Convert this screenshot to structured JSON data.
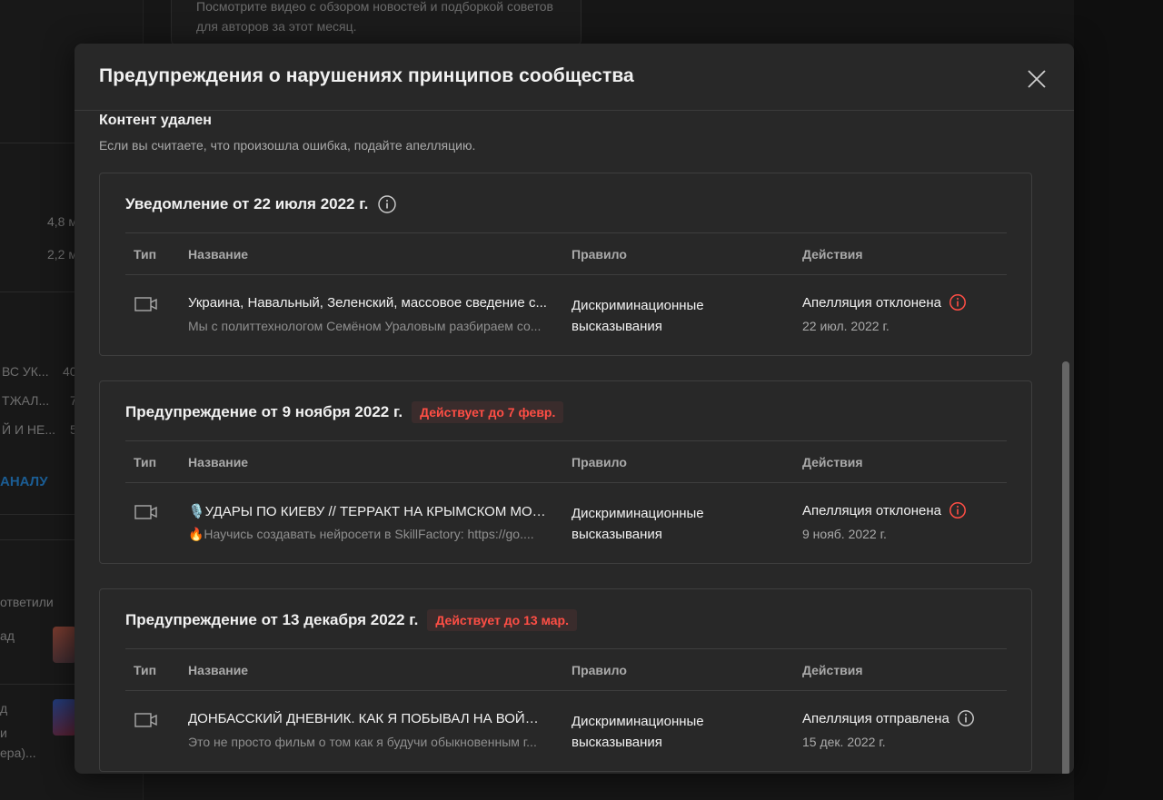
{
  "background": {
    "card_text": "Посмотрите видео с обзором новостей и подборкой советов для авторов за этот месяц.",
    "stats": [
      "4,8 м",
      "2,2 м"
    ],
    "list_rows": [
      {
        "label": "ВС УК...",
        "value": "40"
      },
      {
        "label": "ТЖАЛ...",
        "value": "7"
      },
      {
        "label": "Й И НЕ...",
        "value": "5"
      }
    ],
    "channel_link": "АНАЛУ",
    "comments_header": "ответили",
    "comment_texts": [
      "ад",
      "д",
      "и",
      "ера)..."
    ]
  },
  "modal": {
    "title": "Предупреждения о нарушениях принципов сообщества",
    "section_title": "Контент удален",
    "section_subtitle": "Если вы считаете, что произошла ошибка, подайте апелляцию.",
    "columns": {
      "type": "Тип",
      "name": "Название",
      "rule": "Правило",
      "actions": "Действия"
    },
    "cards": [
      {
        "title": "Уведомление от 22 июля 2022 г.",
        "badge": "",
        "video_title": "Украина, Навальный, Зеленский, массовое сведение с...",
        "video_desc": "Мы с политтехнологом Семёном Ураловым разбираем со...",
        "rule": "Дискриминационные высказывания",
        "action_status": "Апелляция отклонена",
        "action_date": "22 июл. 2022 г."
      },
      {
        "title": "Предупреждение от 9 ноября 2022 г.",
        "badge": "Действует до 7 февр.",
        "video_title": "🎙️УДАРЫ ПО КИЕВУ // ТЕРРАКТ НА КРЫМСКОМ МОС...",
        "video_desc": "🔥Научись создавать нейросети в SkillFactory: https://go....",
        "rule": "Дискриминационные высказывания",
        "action_status": "Апелляция отклонена",
        "action_date": "9 нояб. 2022 г."
      },
      {
        "title": "Предупреждение от 13 декабря 2022 г.",
        "badge": "Действует до 13 мар.",
        "video_title": "ДОНБАССКИЙ ДНЕВНИК. КАК Я ПОБЫВАЛ НА ВОЙНЕ ...",
        "video_desc": "Это не просто фильм о том как я будучи обыкновенным г...",
        "rule": "Дискриминационные высказывания",
        "action_status": "Апелляция отправлена",
        "action_date": "15 дек. 2022 г."
      }
    ]
  },
  "icons": {
    "close": "close-icon",
    "info": "info-icon",
    "alert": "alert-circle-icon",
    "video": "video-camera-icon"
  },
  "colors": {
    "modal_bg": "#282828",
    "accent_red": "#ff4e45",
    "badge_bg": "#3a2c2c",
    "muted_text": "#aaaaaa"
  }
}
